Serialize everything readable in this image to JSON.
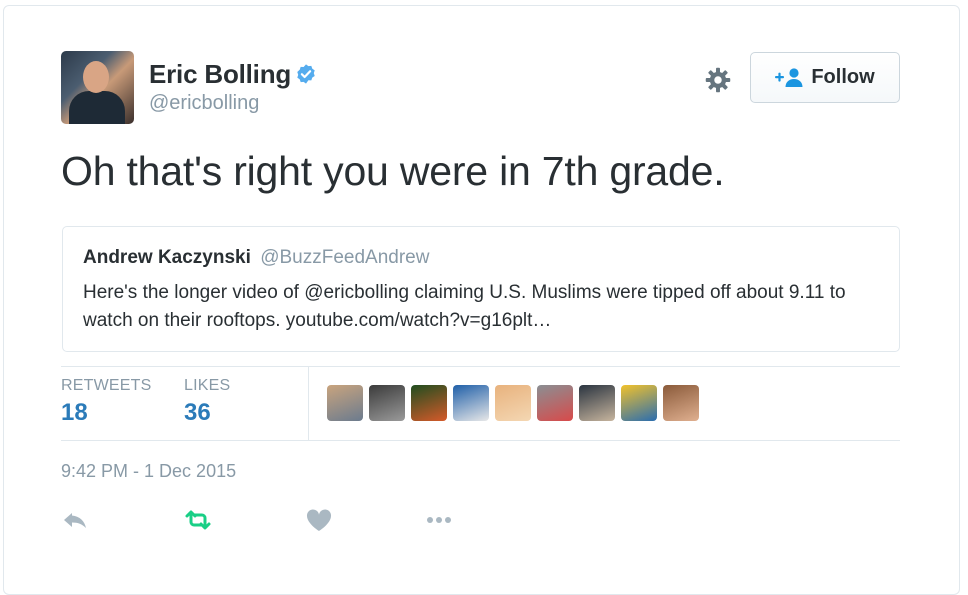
{
  "tweet": {
    "author": {
      "display_name": "Eric Bolling",
      "handle": "@ericbolling",
      "verified": true
    },
    "follow_label": "Follow",
    "text": "Oh that's right you were in 7th grade.",
    "quoted": {
      "name": "Andrew Kaczynski",
      "handle": "@BuzzFeedAndrew",
      "text": "Here's the longer video of @ericbolling claiming U.S. Muslims were tipped off about 9.11 to watch on their rooftops. youtube.com/watch?v=g16plt…"
    },
    "stats": {
      "retweets_label": "RETWEETS",
      "retweets": "18",
      "likes_label": "LIKES",
      "likes": "36"
    },
    "timestamp": "9:42 PM - 1 Dec 2015"
  },
  "icons": [
    "verified-badge-icon",
    "gear-icon",
    "follow-user-icon",
    "reply-icon",
    "retweet-icon",
    "like-heart-icon",
    "more-dots-icon"
  ],
  "colors": {
    "accent_blue": "#2b7bb9",
    "verified_blue": "#55acee",
    "retweet_green": "#19cf86",
    "muted_gray": "#8899a6",
    "text_dark": "#292f33"
  },
  "liker_avatars": [
    {
      "color_a": "#c9a47e",
      "color_b": "#6b7b8e"
    },
    {
      "color_a": "#3b3b3b",
      "color_b": "#9a9a9a"
    },
    {
      "color_a": "#1f4d1f",
      "color_b": "#d65a2a"
    },
    {
      "color_a": "#1f5fa8",
      "color_b": "#e8e8e8"
    },
    {
      "color_a": "#e8b27d",
      "color_b": "#f4d7b3"
    },
    {
      "color_a": "#8a8f93",
      "color_b": "#d84a4a"
    },
    {
      "color_a": "#2a3440",
      "color_b": "#c7b59e"
    },
    {
      "color_a": "#f2c22b",
      "color_b": "#2a6db0"
    },
    {
      "color_a": "#8a5a3a",
      "color_b": "#e0b090"
    }
  ]
}
